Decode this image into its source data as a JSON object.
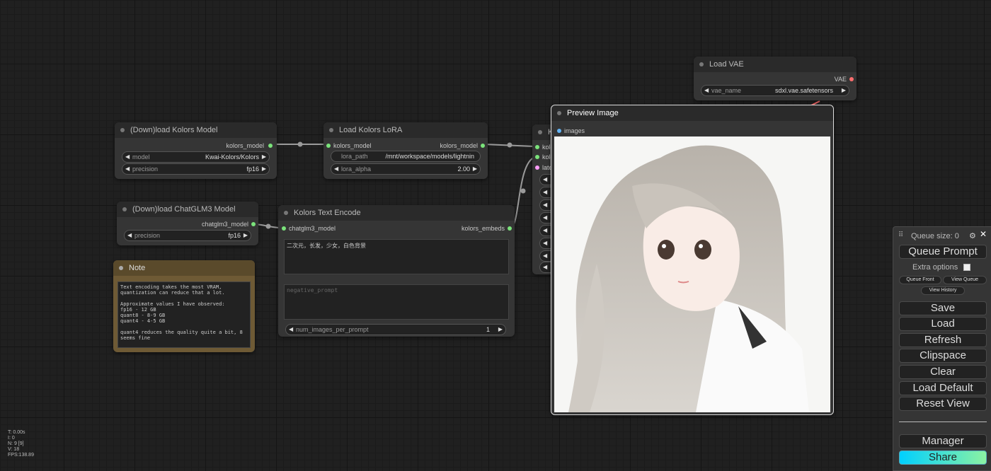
{
  "nodes": {
    "kolors_model": {
      "title": "(Down)load Kolors Model",
      "output": "kolors_model",
      "widgets": [
        {
          "label": "model",
          "value": "Kwai-Kolors/Kolors"
        },
        {
          "label": "precision",
          "value": "fp16"
        }
      ]
    },
    "lora": {
      "title": "Load Kolors LoRA",
      "input": "kolors_model",
      "output": "kolors_model",
      "widgets": [
        {
          "label": "lora_path",
          "value": "/mnt/workspace/models/lightnin"
        },
        {
          "label": "lora_alpha",
          "value": "2.00"
        }
      ]
    },
    "chatglm": {
      "title": "(Down)load ChatGLM3 Model",
      "output": "chatglm3_model",
      "widgets": [
        {
          "label": "precision",
          "value": "fp16"
        }
      ]
    },
    "text_encode": {
      "title": "Kolors Text Encode",
      "input": "chatglm3_model",
      "output": "kolors_embeds",
      "prompt": "二次元，长发，少女，白色背景",
      "negative_placeholder": "negative_prompt",
      "widgets": [
        {
          "label": "num_images_per_prompt",
          "value": "1"
        }
      ]
    },
    "note": {
      "title": "Note",
      "text": "Text encoding takes the most VRAM, quantization can reduce that a lot.\n\nApproximate values I have observed:\nfp16 - 12 GB\nquant8 - 8-9 GB\nquant4 - 4-5 GB\n\nquant4 reduces the quality quite a bit, 8 seems fine"
    },
    "vae": {
      "title": "Load VAE",
      "output": "VAE",
      "widgets": [
        {
          "label": "vae_name",
          "value": "sdxl.vae.safetensors"
        }
      ]
    },
    "preview": {
      "title": "Preview Image",
      "input": "images"
    },
    "sampler": {
      "title_partial": "K",
      "inputs_partial": [
        "kolo",
        "kolo",
        "late"
      ]
    }
  },
  "queue_panel": {
    "queue_size": "Queue size: 0",
    "queue_prompt": "Queue Prompt",
    "extra_options": "Extra options",
    "queue_front": "Queue Front",
    "view_queue": "View Queue",
    "view_history": "View History",
    "buttons": [
      "Save",
      "Load",
      "Refresh",
      "Clipspace",
      "Clear",
      "Load Default",
      "Reset View"
    ],
    "manager": "Manager",
    "share": "Share"
  },
  "stats": {
    "t": "T: 0.00s",
    "i": "I: 0",
    "n": "N: 9 [9]",
    "v": "V: 18",
    "fps": "FPS:138.89"
  },
  "colors": {
    "kolors_model_pin": "#7be37b",
    "chatglm_pin": "#7be37b",
    "embeds_pin": "#7be37b",
    "vae_pin": "#ff6e6e",
    "image_pin": "#64b5f6",
    "latent_pin": "#ff9cf9",
    "note_bg": "#6e5a35",
    "share_gradient_start": "#00d0ff",
    "share_gradient_end": "#8bf2a2"
  }
}
